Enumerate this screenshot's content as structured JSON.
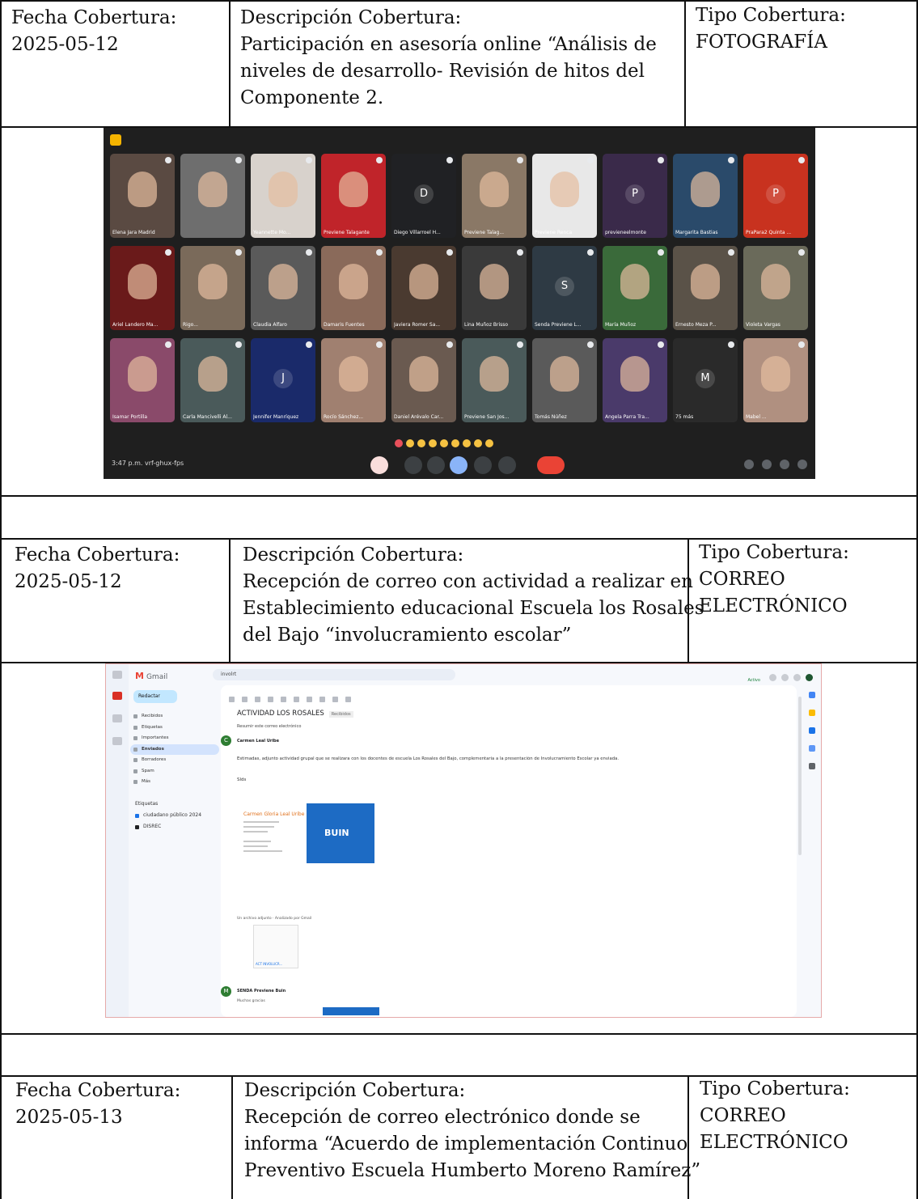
{
  "rows": [
    {
      "fecha_label": "Fecha Cobertura:",
      "fecha_value": "2025-05-12",
      "descripcion_label": "Descripción Cobertura:",
      "descripcion_lines": [
        "Participación en asesoría online “Análisis de",
        "niveles de desarrollo- Revisión de hitos del",
        "Componente 2."
      ],
      "tipo_label": "Tipo Cobertura:",
      "tipo_lines": [
        "FOTOGRAFÍA"
      ]
    },
    {
      "fecha_label": "Fecha Cobertura:",
      "fecha_value": "2025-05-12",
      "descripcion_label": "Descripción Cobertura:",
      "descripcion_lines": [
        "Recepción de correo con actividad a realizar en",
        "Establecimiento educacional Escuela los Rosales",
        "del Bajo “involucramiento escolar”"
      ],
      "tipo_label": "Tipo Cobertura:",
      "tipo_lines": [
        "CORREO",
        "ELECTRÓNICO"
      ]
    },
    {
      "fecha_label": "Fecha Cobertura:",
      "fecha_value": "2025-05-13",
      "descripcion_label": "Descripción Cobertura:",
      "descripcion_lines": [
        "Recepción de correo electrónico donde se",
        "informa “Acuerdo de implementación Continuo",
        "Preventivo Escuela Humberto Moreno Ramírez”"
      ],
      "tipo_label": "Tipo Cobertura:",
      "tipo_lines": [
        "CORREO",
        "ELECTRÓNICO"
      ]
    }
  ],
  "meet": {
    "participants": [
      {
        "name": "Elena Jara Madrid",
        "color": "#5a4a42",
        "initial": ""
      },
      {
        "name": "",
        "color": "#6e6e6e",
        "initial": ""
      },
      {
        "name": "Yeannette Mo...",
        "color": "#d8d2cc",
        "initial": ""
      },
      {
        "name": "Previene Talagante",
        "color": "#c0242a",
        "initial": ""
      },
      {
        "name": "Diego Villarroel H...",
        "color": "#202124",
        "initial": "D"
      },
      {
        "name": "Previene Talag...",
        "color": "#8a7866",
        "initial": ""
      },
      {
        "name": "Previene Renca",
        "color": "#e8e8e8",
        "initial": ""
      },
      {
        "name": "previeneelmonte",
        "color": "#3a2a4a",
        "initial": "P"
      },
      {
        "name": "Margarita Bastias",
        "color": "#2a4a6a",
        "initial": ""
      },
      {
        "name": "PraPara2 Quinta ...",
        "color": "#c8321f",
        "initial": "P"
      },
      {
        "name": "Ariel Landero Ma...",
        "color": "#6a1a1a",
        "initial": ""
      },
      {
        "name": "Rigo...",
        "color": "#7a6a5a",
        "initial": ""
      },
      {
        "name": "Claudia Alfaro",
        "color": "#5a5a5a",
        "initial": ""
      },
      {
        "name": "Damaris Fuentes",
        "color": "#8a6a5a",
        "initial": ""
      },
      {
        "name": "Javiera Romer Sa...",
        "color": "#4a3a30",
        "initial": ""
      },
      {
        "name": "Lina Muñoz Brisso",
        "color": "#3a3a3a",
        "initial": ""
      },
      {
        "name": "Senda Previene L...",
        "color": "#2e3a44",
        "initial": "S"
      },
      {
        "name": "María Muñoz",
        "color": "#3a6a3a",
        "initial": ""
      },
      {
        "name": "Ernesto Meza P...",
        "color": "#5a5248",
        "initial": ""
      },
      {
        "name": "Violeta Vargas",
        "color": "#6a6a5a",
        "initial": ""
      },
      {
        "name": "Isamar Portilla",
        "color": "#8a4a6a",
        "initial": ""
      },
      {
        "name": "Carla Mancivelli Al...",
        "color": "#4a5a5a",
        "initial": ""
      },
      {
        "name": "Jennifer Manríquez",
        "color": "#1a2a6a",
        "initial": "J"
      },
      {
        "name": "Rocío Sánchez...",
        "color": "#a08070",
        "initial": ""
      },
      {
        "name": "Daniel Arévalo Car...",
        "color": "#6a5a50",
        "initial": ""
      },
      {
        "name": "Previene San Jos...",
        "color": "#4a5a5a",
        "initial": ""
      },
      {
        "name": "Tomás Núñez",
        "color": "#5a5a5a",
        "initial": ""
      },
      {
        "name": "Angela Parra Tra...",
        "color": "#4a3a6a",
        "initial": ""
      },
      {
        "name": "75 más",
        "color": "#2a2a2a",
        "initial": "M"
      },
      {
        "name": "Mabel ...",
        "color": "#b09080",
        "initial": ""
      }
    ],
    "time_text": "3:47 p.m.   vrf-ghux-fps"
  },
  "gmail": {
    "app_name": "Gmail",
    "compose_label": "Redactar",
    "search_text": "involrt",
    "nav_items": [
      "Recibidos",
      "Etiquetas",
      "Importantes",
      "Enviados",
      "Borradores",
      "Spam",
      "Más"
    ],
    "labels_heading": "Etiquetas",
    "label_items": [
      {
        "name": "ciudadano público 2024",
        "color": "#1a73e8"
      },
      {
        "name": "DISREC",
        "color": "#202124"
      }
    ],
    "subject": "ACTIVIDAD LOS ROSALES",
    "subject_tag": "Recibidos",
    "summary_line": "Resumir este correo electrónico",
    "sender_1": "Carmen Leal Uribe",
    "sender_1_initial": "C",
    "sender_1_color": "#2e7d32",
    "body_text": "Estimadas, adjunto actividad grupal que se realizara con los docentes de escuela Los Rosales del Bajo, complementaria a la presentación de Involucramiento Escolar ya enviada.",
    "salutation": "Slds",
    "signature_name": "Carmen Gloria Leal Uribe",
    "banner_text": "BUIN",
    "attachment_line": "Un archivo adjunto · Analizado por Gmail",
    "attachment_name": "ACT INVOLUCR...",
    "sender_2": "SENDA Previene Buin",
    "sender_2_initial": "M",
    "sender_2_color": "#2e7d32",
    "reply_text": "Muchas gracias",
    "status_text": "Activo"
  }
}
